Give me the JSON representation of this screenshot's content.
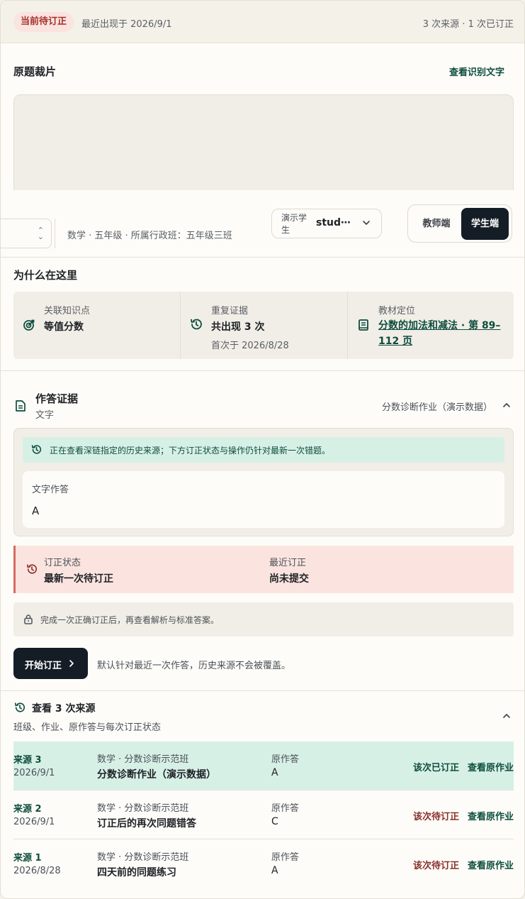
{
  "header": {
    "badge": "当前待订正",
    "last_seen": "最近出现于 2026/9/1",
    "stats": "3 次来源 · 1 次已订正"
  },
  "crop": {
    "title": "原题裁片",
    "view_text_link": "查看识别文字"
  },
  "toolbar": {
    "class_info": "数学 · 五年级 · 所属行政班：五年级三班",
    "student_label": "演示学生",
    "student_value": "stud⋯",
    "role_teacher": "教师端",
    "role_student": "学生端"
  },
  "why": {
    "title": "为什么在这里",
    "knowledge_label": "关联知识点",
    "knowledge_value": "等值分数",
    "repeat_label": "重复证据",
    "repeat_value": "共出现 3 次",
    "repeat_first": "首次于 2026/8/28",
    "textbook_label": "教材定位",
    "textbook_link": "分数的加法和减法 · 第 89–112 页"
  },
  "evidence": {
    "title": "作答证据",
    "subtitle": "文字",
    "homework": "分数诊断作业（演示数据）",
    "notice": "正在查看深链指定的历史来源；下方订正状态与操作仍针对最新一次错题。",
    "answer_label": "文字作答",
    "answer_value": "A"
  },
  "status": {
    "label1": "订正状态",
    "value1": "最新一次待订正",
    "label2": "最近订正",
    "value2": "尚未提交"
  },
  "lock_notice": "完成一次正确订正后，再查看解析与标准答案。",
  "start": {
    "button": "开始订正",
    "hint": "默认针对最近一次作答，历史来源不会被覆盖。"
  },
  "sources": {
    "title": "查看 3 次来源",
    "subtitle": "班级、作业、原作答与每次订正状态",
    "answer_label": "原作答",
    "view_label": "查看原作业",
    "rows": [
      {
        "name": "来源 3",
        "date": "2026/9/1",
        "class": "数学 · 分数诊断示范班",
        "homework": "分数诊断作业（演示数据）",
        "answer": "A",
        "status": "该次已订正"
      },
      {
        "name": "来源 2",
        "date": "2026/9/1",
        "class": "数学 · 分数诊断示范班",
        "homework": "订正后的再次同题错答",
        "answer": "C",
        "status": "该次待订正"
      },
      {
        "name": "来源 1",
        "date": "2026/8/28",
        "class": "数学 · 分数诊断示范班",
        "homework": "四天前的同题练习",
        "answer": "A",
        "status": "该次待订正"
      }
    ]
  },
  "colors": {
    "accent_green": "#0e4d3e",
    "pending_red": "#a3312a",
    "dark_button": "#141c26"
  }
}
